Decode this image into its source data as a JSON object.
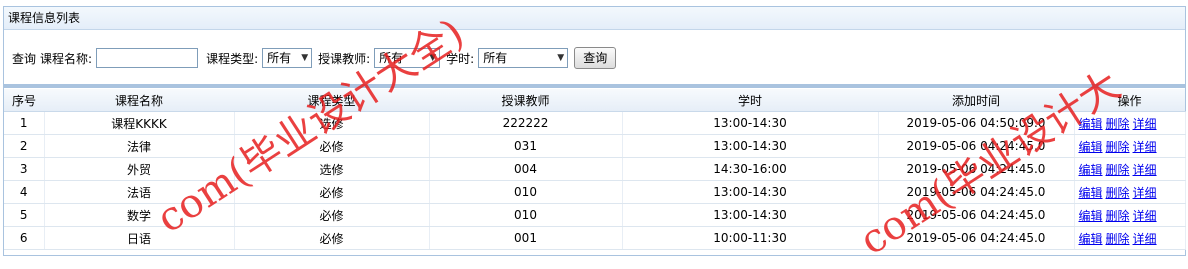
{
  "panel": {
    "title": "课程信息列表"
  },
  "search": {
    "prefix": "查询",
    "course_name_label": "课程名称:",
    "course_name_value": "",
    "course_type_label": "课程类型:",
    "course_type_value": "所有",
    "teacher_label": "授课教师:",
    "teacher_value": "所有",
    "hours_label": "学时:",
    "hours_value": "所有",
    "query_button": "查询"
  },
  "table": {
    "headers": [
      "序号",
      "课程名称",
      "课程类型",
      "授课教师",
      "学时",
      "添加时间",
      "操作"
    ],
    "rows": [
      [
        "1",
        "课程KKKK",
        "选修",
        "222222",
        "13:00-14:30",
        "2019-05-06 04:50:09.0"
      ],
      [
        "2",
        "法律",
        "必修",
        "031",
        "13:00-14:30",
        "2019-05-06 04:24:45.0"
      ],
      [
        "3",
        "外贸",
        "选修",
        "004",
        "14:30-16:00",
        "2019-05-06 04:24:45.0"
      ],
      [
        "4",
        "法语",
        "必修",
        "010",
        "13:00-14:30",
        "2019-05-06 04:24:45.0"
      ],
      [
        "5",
        "数学",
        "必修",
        "010",
        "13:00-14:30",
        "2019-05-06 04:24:45.0"
      ],
      [
        "6",
        "日语",
        "必修",
        "001",
        "10:00-11:30",
        "2019-05-06 04:24:45.0"
      ]
    ],
    "actions": {
      "edit": "编辑",
      "delete": "删除",
      "detail": "详细"
    }
  },
  "watermark": {
    "text1": "com(毕业设计大全)",
    "text2": "com(毕业设计大"
  },
  "colors": {
    "border": "#a9c3df",
    "link": "#0000ee",
    "watermark": "#e61e1e"
  },
  "icons": {
    "select_arrow": "dropdown-arrow-icon"
  }
}
